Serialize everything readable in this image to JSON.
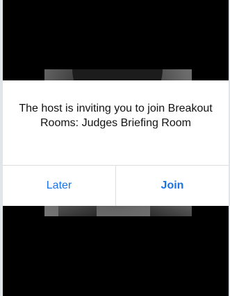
{
  "dialog": {
    "message": "The host is inviting you to join Breakout Rooms: Judges Briefing Room",
    "later_label": "Later",
    "join_label": "Join"
  },
  "colors": {
    "accent": "#1a73e8",
    "backdrop": "#000000",
    "dialog_bg": "#ffffff"
  }
}
